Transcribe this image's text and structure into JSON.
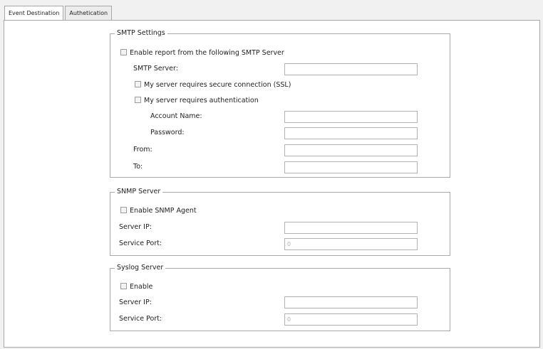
{
  "tabs": [
    {
      "label": "Event Destination",
      "active": true
    },
    {
      "label": "Authetication",
      "active": false
    }
  ],
  "smtp": {
    "legend": "SMTP Settings",
    "enable_label": "Enable report from the following SMTP Server",
    "server_label": "SMTP Server:",
    "server_value": "",
    "ssl_label": "My server requires secure connection (SSL)",
    "auth_label": "My server requires authentication",
    "account_label": "Account Name:",
    "account_value": "",
    "password_label": "Password:",
    "password_value": "",
    "from_label": "From:",
    "from_value": "",
    "to_label": "To:",
    "to_value": ""
  },
  "snmp": {
    "legend": "SNMP Server",
    "enable_label": "Enable SNMP Agent",
    "ip_label": "Server IP:",
    "ip_value": "",
    "port_label": "Service Port:",
    "port_value": "0"
  },
  "syslog": {
    "legend": "Syslog Server",
    "enable_label": "Enable",
    "ip_label": "Server IP:",
    "ip_value": "",
    "port_label": "Service Port:",
    "port_value": "0"
  }
}
